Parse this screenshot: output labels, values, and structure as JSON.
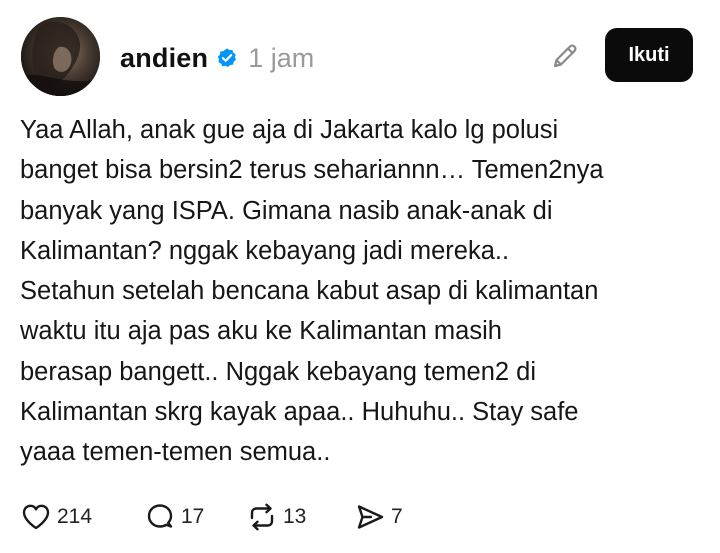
{
  "post": {
    "author": {
      "username": "andien",
      "verified": true
    },
    "timestamp": "1 jam",
    "follow_label": "Ikuti",
    "text_lines": [
      "Yaa Allah, anak gue aja di Jakarta kalo lg polusi",
      "banget bisa bersin2 terus sehariannn… Temen2nya",
      "banyak yang ISPA. Gimana nasib anak-anak di",
      "Kalimantan? nggak kebayang jadi mereka..",
      "Setahun setelah bencana kabut asap di kalimantan",
      "waktu itu aja pas aku ke Kalimantan masih",
      "berasap bangett.. Nggak kebayang temen2 di",
      "Kalimantan skrg kayak apaa.. Huhuhu.. Stay safe",
      "yaaa temen-temen semua.."
    ],
    "stats": {
      "likes": "214",
      "replies": "17",
      "reposts": "13",
      "shares": "7"
    }
  },
  "icons": {
    "verified": "verified-badge-icon",
    "edit": "pencil-icon",
    "like": "heart-icon",
    "reply": "speech-bubble-icon",
    "repost": "repost-icon",
    "share": "send-icon"
  },
  "colors": {
    "verified_badge": "#0095f6",
    "follow_button_bg": "#0b0b0b",
    "timestamp": "#9a9a9a"
  }
}
